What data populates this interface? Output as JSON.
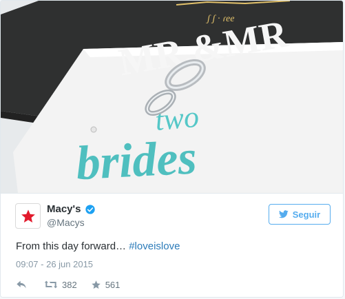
{
  "photo": {
    "card_text": "MR.&MR",
    "glitter_text_1": "two",
    "glitter_text_2": "brides"
  },
  "tweet": {
    "display_name": "Macy's",
    "handle": "@Macys",
    "follow_label": "Seguir",
    "text_prefix": "From this day forward… ",
    "hashtag": "#loveislove",
    "timestamp": "09:07 - 26 jun 2015",
    "retweet_count": "382",
    "like_count": "561"
  },
  "colors": {
    "brand_red": "#e21a2c",
    "twitter_blue": "#55acee",
    "link_blue": "#2b7bb9",
    "glitter_teal": "#55c7c7",
    "gold": "#e3c26b"
  }
}
